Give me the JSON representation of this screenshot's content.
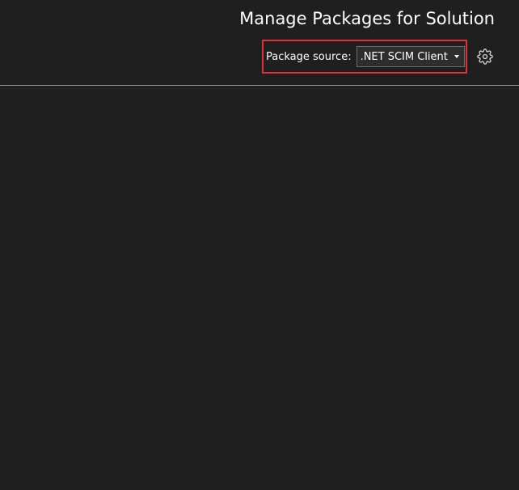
{
  "header": {
    "title": "Manage Packages for Solution"
  },
  "package_source": {
    "label": "Package source:",
    "selected": ".NET SCIM Client"
  },
  "icons": {
    "settings": "gear-icon",
    "dropdown": "chevron-down-icon"
  },
  "colors": {
    "background": "#1f1f1f",
    "highlight_border": "#e0303a",
    "divider": "#9a9a9a"
  }
}
